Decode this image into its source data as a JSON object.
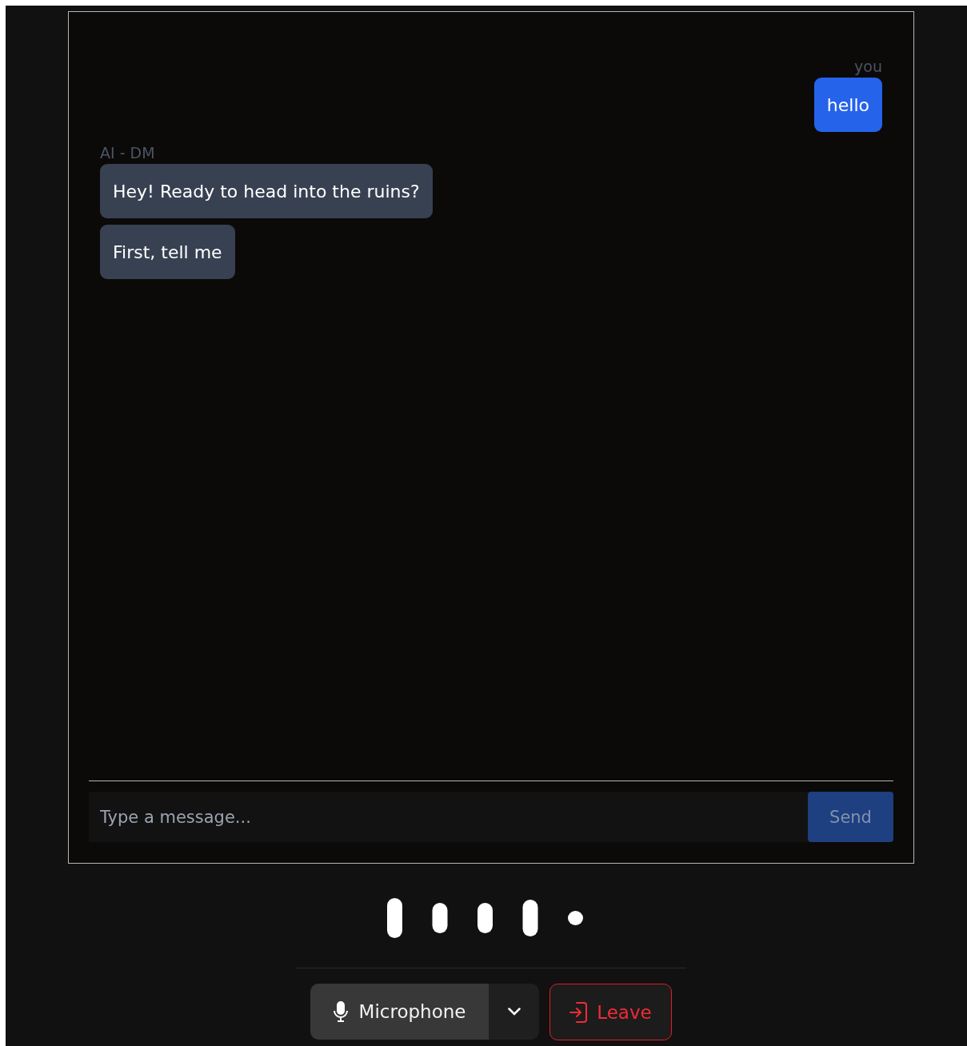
{
  "chat": {
    "groups": [
      {
        "kind": "user",
        "sender": "you",
        "messages": [
          "hello"
        ]
      },
      {
        "kind": "agent",
        "sender": "AI - DM",
        "messages": [
          "Hey! Ready to head into the ruins?",
          "First, tell me"
        ]
      }
    ],
    "input": {
      "placeholder": "Type a message..."
    },
    "send_button": {
      "label": "Send",
      "disabled": true
    }
  },
  "controls": {
    "microphone_button": {
      "label": "Microphone"
    },
    "leave_button": {
      "label": "Leave"
    }
  }
}
